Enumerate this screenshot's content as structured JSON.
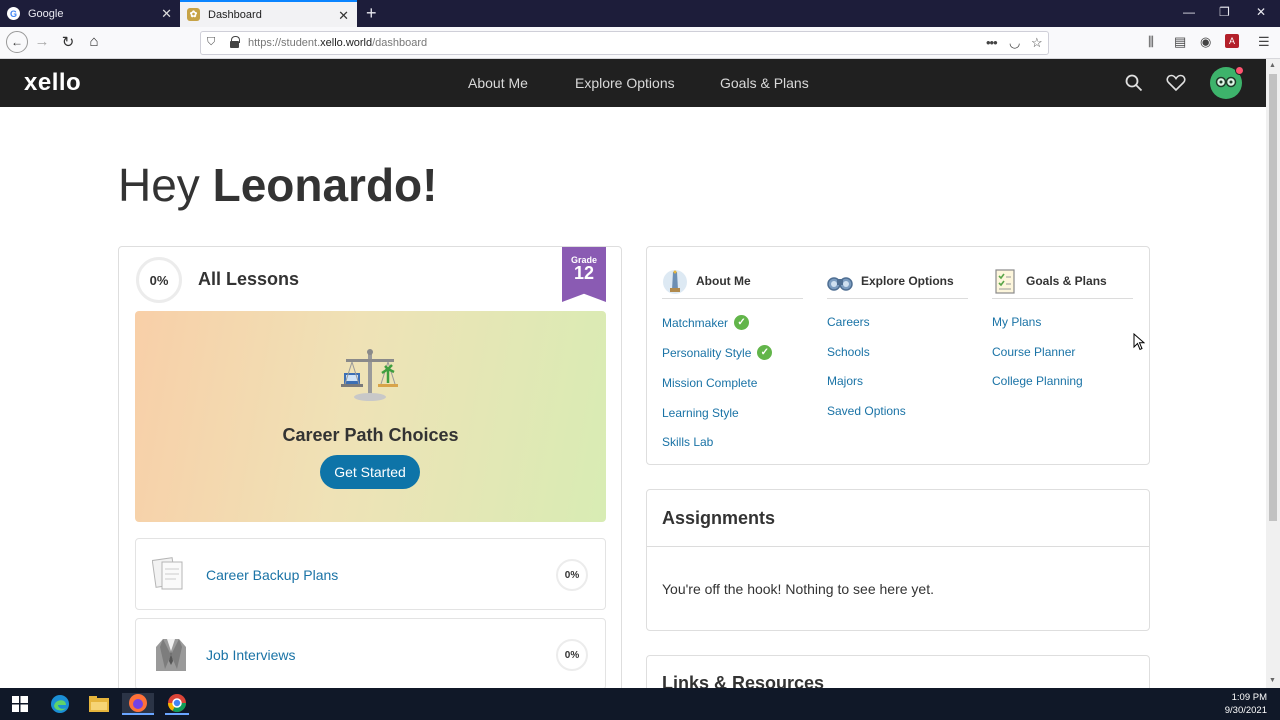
{
  "browser": {
    "tabs": [
      {
        "title": "Google",
        "favicon": "google-favicon"
      },
      {
        "title": "Dashboard",
        "favicon": "xello-favicon"
      }
    ],
    "url_prefix": "https://student.",
    "url_domain": "xello.world",
    "url_path": "/dashboard",
    "accent_color": "#0a84ff"
  },
  "header": {
    "logo": "xello",
    "nav": [
      "About Me",
      "Explore Options",
      "Goals & Plans"
    ],
    "background": "#202020"
  },
  "greeting": {
    "prefix": "Hey",
    "name": "Leonardo!"
  },
  "lessons": {
    "progress_label": "0%",
    "title": "All Lessons",
    "grade_label": "Grade",
    "grade_number": "12",
    "grade_color": "#8a5bb3",
    "featured": {
      "title": "Career Path Choices",
      "button": "Get Started"
    },
    "items": [
      {
        "name": "Career Backup Plans",
        "percent": "0%"
      },
      {
        "name": "Job Interviews",
        "percent": "0%"
      }
    ]
  },
  "quicklinks": {
    "columns": [
      {
        "title": "About Me",
        "icon": "tower-icon",
        "links": [
          {
            "label": "Matchmaker",
            "complete": true
          },
          {
            "label": "Personality Style",
            "complete": true
          },
          {
            "label": "Mission Complete",
            "complete": false
          },
          {
            "label": "Learning Style",
            "complete": false
          },
          {
            "label": "Skills Lab",
            "complete": false
          }
        ]
      },
      {
        "title": "Explore Options",
        "icon": "binoculars-icon",
        "links": [
          {
            "label": "Careers"
          },
          {
            "label": "Schools"
          },
          {
            "label": "Majors"
          },
          {
            "label": "Saved Options"
          }
        ]
      },
      {
        "title": "Goals & Plans",
        "icon": "checklist-icon",
        "links": [
          {
            "label": "My Plans"
          },
          {
            "label": "Course Planner"
          },
          {
            "label": "College Planning"
          }
        ]
      }
    ],
    "link_color": "#1a73a6",
    "check_color": "#62b54a"
  },
  "assignments": {
    "title": "Assignments",
    "empty_text": "You're off the hook! Nothing to see here yet."
  },
  "resources": {
    "title": "Links & Resources"
  },
  "taskbar": {
    "time": "1:09 PM",
    "date": "9/30/2021"
  }
}
